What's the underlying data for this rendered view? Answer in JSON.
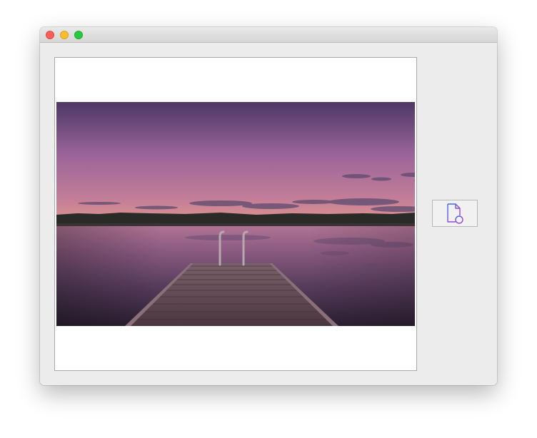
{
  "window": {
    "traffic_lights": [
      {
        "name": "close",
        "color": "#fc5f57"
      },
      {
        "name": "minimize",
        "color": "#fdbc2e"
      },
      {
        "name": "zoom",
        "color": "#28c840"
      }
    ]
  },
  "main": {
    "photo": {
      "subject": "lake-dock-sunset-photo",
      "colors": {
        "sky_top": "#4d3766",
        "sky_mid": "#9a6499",
        "horizon": "#cf8b96",
        "water_top": "#a86e92",
        "water_bottom": "#2c1f33",
        "dock": "#5a434d"
      }
    },
    "tool_button": {
      "icon": "document-search-icon",
      "colors": {
        "start": "#3b6cf0",
        "end": "#b23ad6"
      }
    }
  }
}
